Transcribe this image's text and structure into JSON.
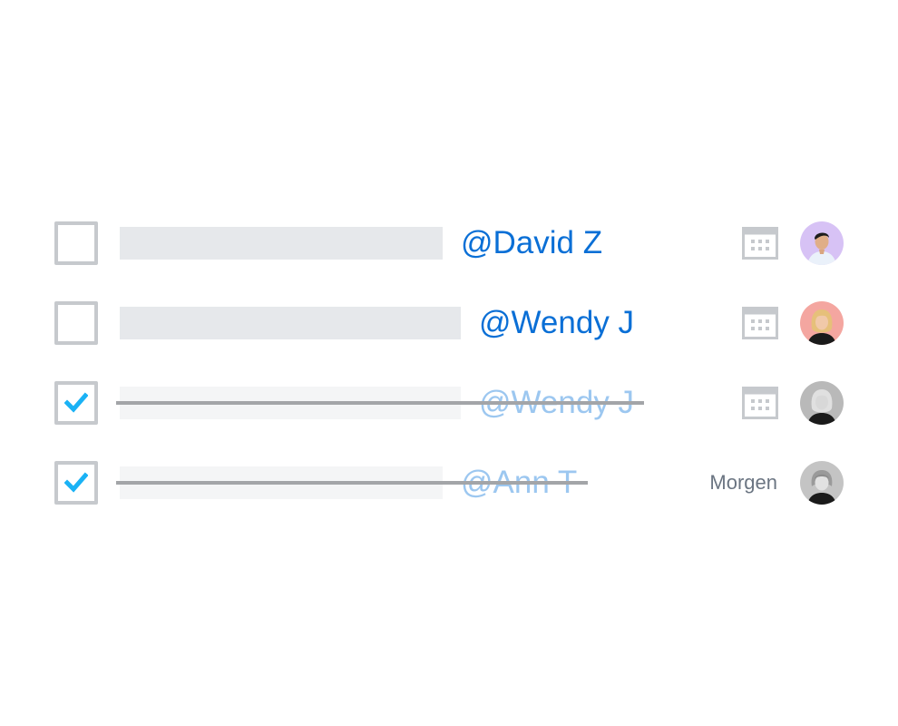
{
  "tasks": [
    {
      "mention": "@David Z",
      "completed": false,
      "due_label": "",
      "assignee_avatar": "avatar-david-z",
      "avatar_bg": "#d7c2f5"
    },
    {
      "mention": "@Wendy J",
      "completed": false,
      "due_label": "",
      "assignee_avatar": "avatar-wendy-j",
      "avatar_bg": "#f4a6a0"
    },
    {
      "mention": "@Wendy J",
      "completed": true,
      "due_label": "",
      "assignee_avatar": "avatar-wendy-j",
      "avatar_bg": "#b9b9b9"
    },
    {
      "mention": "@Ann T",
      "completed": true,
      "due_label": "Morgen",
      "assignee_avatar": "avatar-ann-t",
      "avatar_bg": "#c4c4c4"
    }
  ],
  "icons": {
    "checkmark": "checkmark-icon",
    "calendar": "calendar-icon"
  },
  "colors": {
    "mention": "#0a6fd6",
    "mention_done": "#9cc7f0",
    "checkmark": "#1ab2f5",
    "checkbox_border": "#c6c9cd",
    "placeholder": "#e6e8eb",
    "strike": "#a3a5a8",
    "due_text": "#6b7582"
  }
}
